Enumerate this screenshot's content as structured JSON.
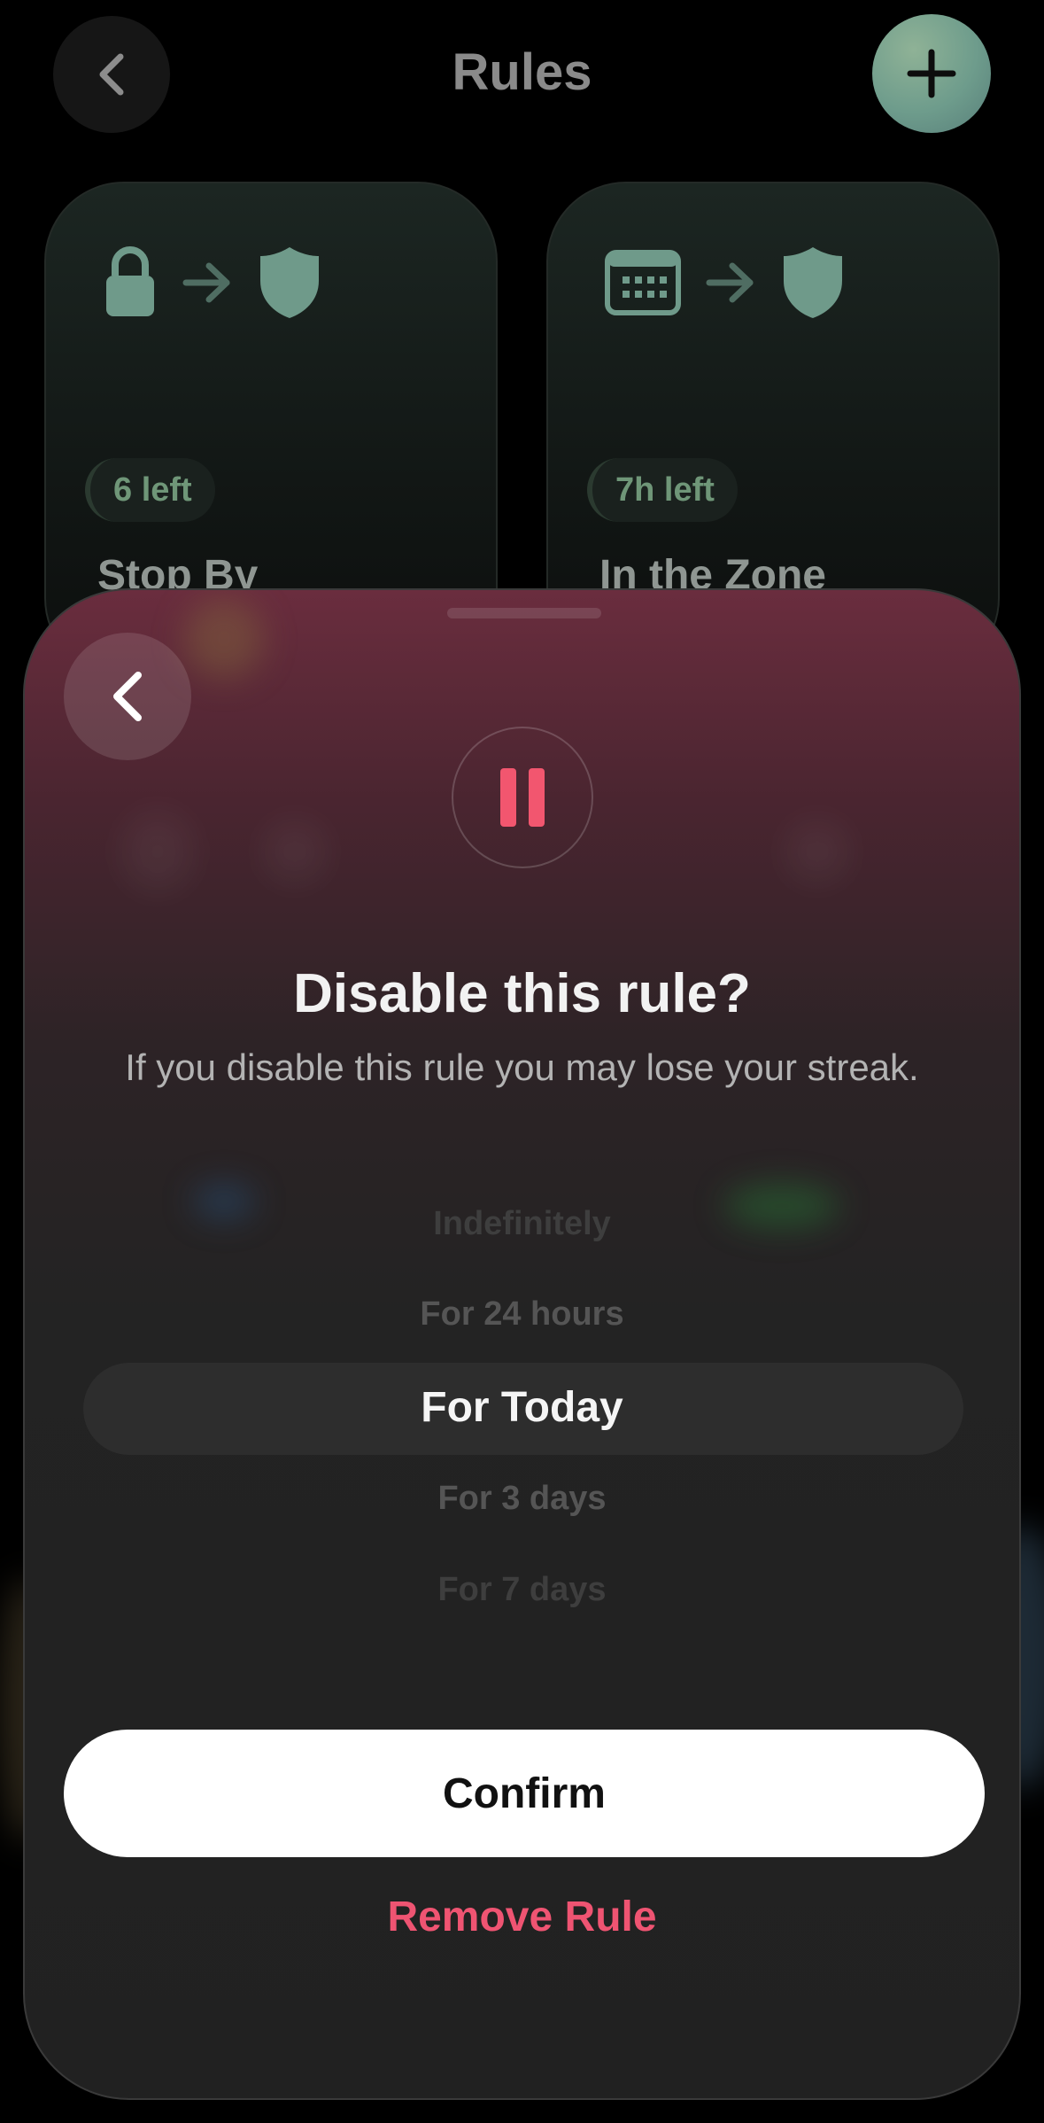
{
  "header": {
    "title": "Rules",
    "back_icon": "chevron-left-icon",
    "add_icon": "plus-icon"
  },
  "cards": [
    {
      "name": "Stop By",
      "badge": "6 left",
      "icons": [
        "lock-icon",
        "arrow-right-icon",
        "shield-icon"
      ]
    },
    {
      "name": "In the Zone",
      "badge": "7h left",
      "icons": [
        "calendar-icon",
        "arrow-right-icon",
        "shield-icon"
      ]
    }
  ],
  "sheet": {
    "back_icon": "chevron-left-icon",
    "status_icon": "pause-icon",
    "title": "Disable this rule?",
    "subtitle": "If you disable this rule you may lose your streak.",
    "picker": {
      "options": [
        "Indefinitely",
        "For 24 hours",
        "For Today",
        "For 3 days",
        "For 7 days"
      ],
      "selected": "For Today"
    },
    "confirm_label": "Confirm",
    "remove_label": "Remove Rule"
  },
  "colors": {
    "accent_green": "#6f9678",
    "accent_pink": "#ef5472",
    "sheet_top": "#6a2d3e",
    "background": "#000000"
  }
}
